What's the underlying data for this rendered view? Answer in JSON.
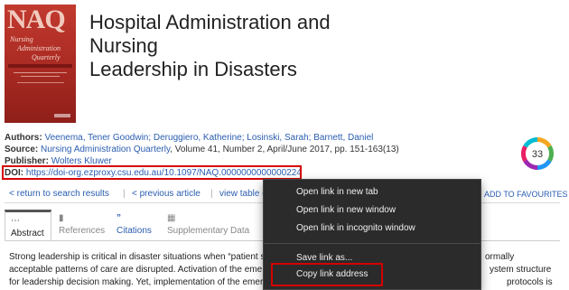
{
  "article": {
    "title_line1": "Hospital Administration and Nursing",
    "title_line2": "Leadership in Disasters",
    "authors_label": "Authors:",
    "authors": "Veenema, Tener Goodwin; Deruggiero, Katherine; Losinski, Sarah; Barnett, Daniel",
    "source_label": "Source:",
    "source_journal": "Nursing Administration Quarterly",
    "source_details": ", Volume 41, Number 2, April/June 2017, pp. 151-163(13)",
    "publisher_label": "Publisher:",
    "publisher": "Wolters Kluwer",
    "doi_label": "DOI:",
    "doi_url": "https://doi-org.ezproxy.csu.edu.au/10.1097/NAQ.0000000000000224",
    "cover_title": "NAQ",
    "cover_subtitle1": "Nursing",
    "cover_subtitle2": "Administration",
    "cover_subtitle3": "Quarterly"
  },
  "badge": {
    "value": "33"
  },
  "nav": {
    "back": "< return to search results",
    "previous": "< previous article",
    "view_toc": "view table o",
    "add_favourites": "ADD TO FAVOURITES"
  },
  "tabs": [
    {
      "icon": "⋯",
      "label": "Abstract"
    },
    {
      "icon": "▮",
      "label": "References"
    },
    {
      "icon": "”",
      "label": "Citations"
    },
    {
      "icon": "▦",
      "label": "Supplementary Data"
    }
  ],
  "abstract": {
    "line1_left": "Strong leadership is critical in disaster situations when “patient s",
    "line1_right": "ormally",
    "line2_left": "acceptable patterns of care are disrupted. Activation of the eme",
    "line2_right": "ystem structure",
    "line3_left": "for leadership decision making. Yet, implementation of the emer",
    "line3_right": "protocols is"
  },
  "context_menu": {
    "items": [
      "Open link in new tab",
      "Open link in new window",
      "Open link in incognito window",
      "Save link as...",
      "Copy link address"
    ]
  },
  "colors": {
    "link": "#2a5db0",
    "highlight_border": "#d40000",
    "menu_bg": "#2b2b2b"
  }
}
